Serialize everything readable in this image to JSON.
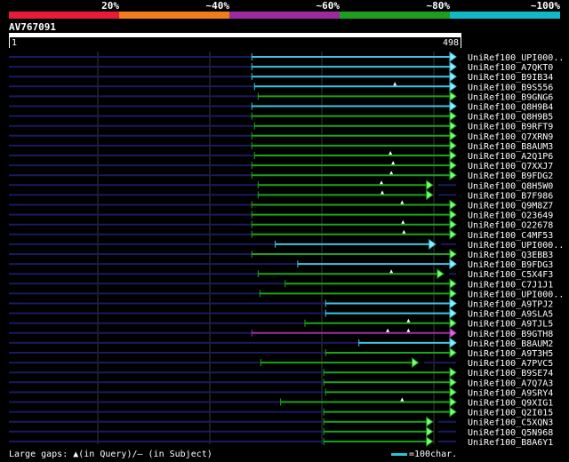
{
  "legend": [
    {
      "label": "20%",
      "color": "#e81c38"
    },
    {
      "label": "~40%",
      "color": "#f07c1c"
    },
    {
      "label": "~60%",
      "color": "#9e2aa0"
    },
    {
      "label": "~80%",
      "color": "#1e9e1e"
    },
    {
      "label": "~100%",
      "color": "#10b8c8"
    }
  ],
  "query": {
    "name": "AV767091",
    "start": "1",
    "end": "498",
    "length": 498
  },
  "hits": [
    {
      "name": "UniRef100_UPI000..",
      "start": 271,
      "end": 498,
      "color": "cyan",
      "gaps": []
    },
    {
      "name": "UniRef100_A7QKT0",
      "start": 271,
      "end": 498,
      "color": "cyan",
      "gaps": []
    },
    {
      "name": "UniRef100_B9IB34",
      "start": 271,
      "end": 498,
      "color": "cyan",
      "gaps": []
    },
    {
      "name": "UniRef100_B9S556",
      "start": 274,
      "end": 498,
      "color": "cyan",
      "gaps": [
        430
      ]
    },
    {
      "name": "UniRef100_B9GNG6",
      "start": 278,
      "end": 498,
      "color": "green",
      "gaps": []
    },
    {
      "name": "UniRef100_Q8H9B4",
      "start": 271,
      "end": 498,
      "color": "cyan",
      "gaps": []
    },
    {
      "name": "UniRef100_Q8H9B5",
      "start": 271,
      "end": 498,
      "color": "green",
      "gaps": []
    },
    {
      "name": "UniRef100_B9RFT9",
      "start": 274,
      "end": 498,
      "color": "green",
      "gaps": []
    },
    {
      "name": "UniRef100_Q7XRN9",
      "start": 271,
      "end": 498,
      "color": "green",
      "gaps": []
    },
    {
      "name": "UniRef100_B8AUM3",
      "start": 271,
      "end": 498,
      "color": "green",
      "gaps": []
    },
    {
      "name": "UniRef100_A2Q1P6",
      "start": 274,
      "end": 498,
      "color": "green",
      "gaps": [
        425
      ]
    },
    {
      "name": "UniRef100_Q7XXJ7",
      "start": 271,
      "end": 498,
      "color": "green",
      "gaps": [
        428
      ]
    },
    {
      "name": "UniRef100_B9FDG2",
      "start": 271,
      "end": 498,
      "color": "green",
      "gaps": [
        426
      ]
    },
    {
      "name": "UniRef100_Q8H5W0",
      "start": 278,
      "end": 472,
      "color": "green",
      "gaps": [
        415
      ]
    },
    {
      "name": "UniRef100_B7F986",
      "start": 278,
      "end": 472,
      "color": "green",
      "gaps": [
        416
      ]
    },
    {
      "name": "UniRef100_Q9M8Z7",
      "start": 271,
      "end": 498,
      "color": "green",
      "gaps": [
        438
      ]
    },
    {
      "name": "UniRef100_O23649",
      "start": 271,
      "end": 498,
      "color": "green",
      "gaps": []
    },
    {
      "name": "UniRef100_O22678",
      "start": 271,
      "end": 498,
      "color": "green",
      "gaps": [
        439
      ]
    },
    {
      "name": "UniRef100_C4MF53",
      "start": 271,
      "end": 498,
      "color": "green",
      "gaps": [
        440
      ]
    },
    {
      "name": "UniRef100_UPI000..",
      "start": 297,
      "end": 475,
      "color": "cyan",
      "gaps": []
    },
    {
      "name": "UniRef100_Q3EBB3",
      "start": 271,
      "end": 498,
      "color": "green",
      "gaps": []
    },
    {
      "name": "UniRef100_B9FDG3",
      "start": 322,
      "end": 498,
      "color": "cyan",
      "gaps": []
    },
    {
      "name": "UniRef100_C5X4F3",
      "start": 278,
      "end": 484,
      "color": "green",
      "gaps": [
        426
      ]
    },
    {
      "name": "UniRef100_C7J1J1",
      "start": 308,
      "end": 498,
      "color": "green",
      "gaps": []
    },
    {
      "name": "UniRef100_UPI000..",
      "start": 280,
      "end": 498,
      "color": "green",
      "gaps": []
    },
    {
      "name": "UniRef100_A9TPJ2",
      "start": 353,
      "end": 498,
      "color": "cyan",
      "gaps": []
    },
    {
      "name": "UniRef100_A9SLA5",
      "start": 353,
      "end": 498,
      "color": "cyan",
      "gaps": []
    },
    {
      "name": "UniRef100_A9TJL5",
      "start": 330,
      "end": 498,
      "color": "green",
      "gaps": [
        445
      ]
    },
    {
      "name": "UniRef100_B9GTH8",
      "start": 271,
      "end": 498,
      "color": "purple",
      "gaps": [
        422,
        445
      ]
    },
    {
      "name": "UniRef100_B8AUM2",
      "start": 390,
      "end": 498,
      "color": "cyan",
      "gaps": []
    },
    {
      "name": "UniRef100_A9T3H5",
      "start": 353,
      "end": 498,
      "color": "green",
      "gaps": []
    },
    {
      "name": "UniRef100_A7PVC5",
      "start": 281,
      "end": 456,
      "color": "green",
      "gaps": []
    },
    {
      "name": "UniRef100_B9SE74",
      "start": 351,
      "end": 498,
      "color": "green",
      "gaps": []
    },
    {
      "name": "UniRef100_A7Q7A3",
      "start": 351,
      "end": 498,
      "color": "green",
      "gaps": []
    },
    {
      "name": "UniRef100_A9SRY4",
      "start": 353,
      "end": 498,
      "color": "green",
      "gaps": []
    },
    {
      "name": "UniRef100_Q9XIG1",
      "start": 303,
      "end": 498,
      "color": "green",
      "gaps": [
        438
      ]
    },
    {
      "name": "UniRef100_Q2I015",
      "start": 351,
      "end": 498,
      "color": "green",
      "gaps": []
    },
    {
      "name": "UniRef100_C5XQN3",
      "start": 351,
      "end": 472,
      "color": "green",
      "gaps": []
    },
    {
      "name": "UniRef100_Q5N968",
      "start": 351,
      "end": 472,
      "color": "green",
      "gaps": []
    },
    {
      "name": "UniRef100_B8A6Y1",
      "start": 351,
      "end": 472,
      "color": "green",
      "gaps": []
    }
  ],
  "footer": {
    "text": "Large gaps: ▲(in Query)/– (in Subject)",
    "scale_label": "=100char."
  },
  "colors": {
    "cyan": "#3ec6e0",
    "green": "#1aa51a",
    "purple": "#9c2ea4",
    "navy": "#1a1a60",
    "grid": "#3a3a3a"
  }
}
